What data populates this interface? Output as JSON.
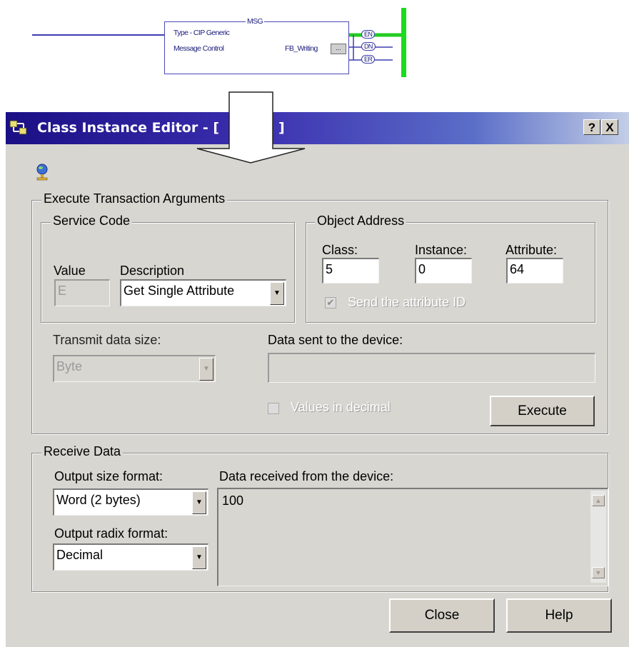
{
  "ladder": {
    "instruction": "MSG",
    "line1": "Type - CIP Generic",
    "line2": "Message Control",
    "tag": "FB_Writing",
    "browse": "...",
    "bits": [
      "EN",
      "DN",
      "ER"
    ]
  },
  "window": {
    "title": "Class Instance Editor - [",
    "title_tail": "]",
    "help_button": "?",
    "close_button": "X"
  },
  "execute": {
    "group_label": "Execute Transaction Arguments",
    "service_code": {
      "label": "Service Code",
      "value_label": "Value",
      "value": "E",
      "description_label": "Description",
      "description_selected": "Get Single Attribute"
    },
    "object_address": {
      "label": "Object Address",
      "class_label": "Class:",
      "class_value": "5",
      "instance_label": "Instance:",
      "instance_value": "0",
      "attribute_label": "Attribute:",
      "attribute_value": "64",
      "send_attr_label": "Send the attribute ID"
    },
    "transmit_size_label": "Transmit data size:",
    "transmit_size_value": "Byte",
    "data_sent_label": "Data sent to the device:",
    "data_sent_value": "",
    "decimal_label": "Values in decimal",
    "execute_button": "Execute"
  },
  "receive": {
    "group_label": "Receive Data",
    "size_format_label": "Output size format:",
    "size_format_value": "Word (2 bytes)",
    "radix_format_label": "Output radix format:",
    "radix_format_value": "Decimal",
    "data_received_label": "Data received from the device:",
    "data_received_value": "100"
  },
  "buttons": {
    "close": "Close",
    "help": "Help"
  }
}
